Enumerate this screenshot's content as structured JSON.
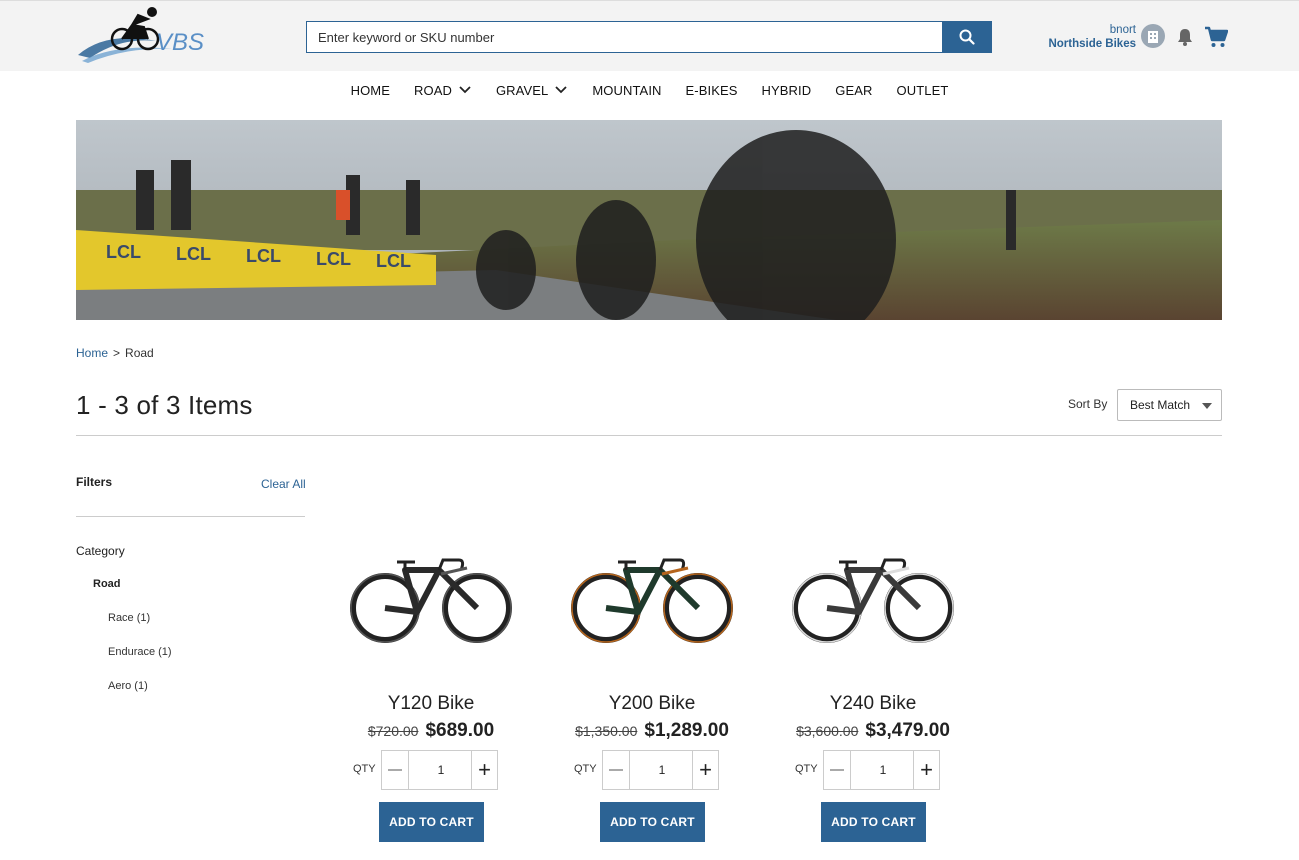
{
  "header": {
    "logo_text": "VBS",
    "search": {
      "placeholder": "Enter keyword or SKU number"
    },
    "account": {
      "user": "bnort",
      "store": "Northside Bikes"
    }
  },
  "nav": {
    "items": [
      {
        "label": "HOME",
        "has_dropdown": false
      },
      {
        "label": "ROAD",
        "has_dropdown": true
      },
      {
        "label": "GRAVEL",
        "has_dropdown": true
      },
      {
        "label": "MOUNTAIN",
        "has_dropdown": false
      },
      {
        "label": "E-BIKES",
        "has_dropdown": false
      },
      {
        "label": "HYBRID",
        "has_dropdown": false
      },
      {
        "label": "GEAR",
        "has_dropdown": false
      },
      {
        "label": "OUTLET",
        "has_dropdown": false
      }
    ]
  },
  "hero": {
    "banner_text": "LCL"
  },
  "breadcrumb": {
    "home": "Home",
    "separator": ">",
    "current": "Road"
  },
  "listing": {
    "count_text": "1 - 3 of 3 Items",
    "sort_label": "Sort By",
    "sort_value": "Best Match"
  },
  "filters": {
    "title": "Filters",
    "clear_all": "Clear All",
    "category_label": "Category",
    "category_selected": "Road",
    "subcategories": [
      "Race (1)",
      "Endurace (1)",
      "Aero (1)"
    ]
  },
  "products": [
    {
      "name": "Y120 Bike",
      "old_price": "$720.00",
      "price": "$689.00",
      "qty_label": "QTY",
      "qty": "1",
      "add_label": "ADD TO CART",
      "frame_color": "#2a2a2a",
      "accent": "#555555"
    },
    {
      "name": "Y200 Bike",
      "old_price": "$1,350.00",
      "price": "$1,289.00",
      "qty_label": "QTY",
      "qty": "1",
      "add_label": "ADD TO CART",
      "frame_color": "#1f3a2c",
      "accent": "#b5651d"
    },
    {
      "name": "Y240 Bike",
      "old_price": "$3,600.00",
      "price": "$3,479.00",
      "qty_label": "QTY",
      "qty": "1",
      "add_label": "ADD TO CART",
      "frame_color": "#3a3a3a",
      "accent": "#dddddd"
    }
  ],
  "colors": {
    "primary": "#2c6394",
    "header_bg": "#f3f3f3"
  }
}
